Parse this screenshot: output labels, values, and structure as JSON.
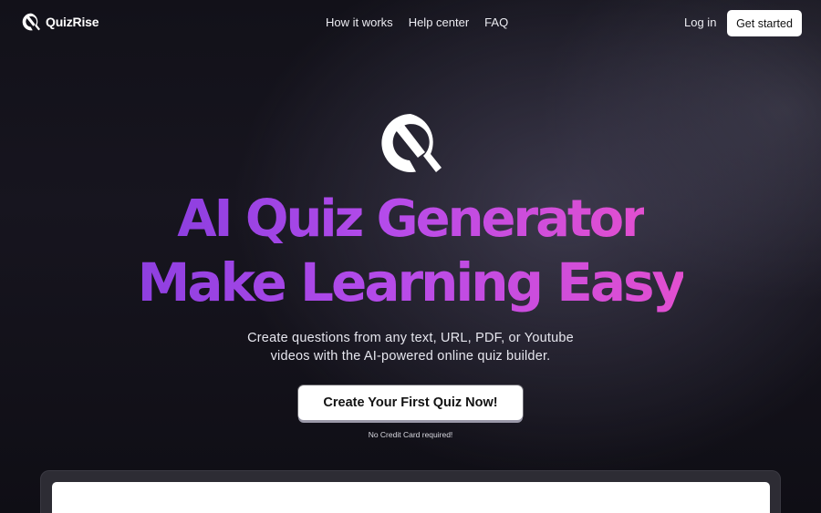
{
  "nav": {
    "brand_name": "QuizRise",
    "links": [
      "How it works",
      "Help center",
      "FAQ"
    ],
    "login_label": "Log in",
    "get_started_label": "Get started"
  },
  "hero": {
    "headline_line1": "AI Quiz Generator",
    "headline_line2": "Make Learning Easy",
    "subtitle_line1": "Create questions from any text, URL, PDF, or Youtube",
    "subtitle_line2": "videos with the AI-powered online quiz builder.",
    "cta_label": "Create Your First Quiz Now!",
    "cta_note": "No Credit Card required!"
  },
  "icons": {
    "brand_logo": "quizrise-logo-icon",
    "hero_logo": "quizrise-logo-icon"
  },
  "colors": {
    "gradient_start": "#8e3fe0",
    "gradient_mid": "#b54bea",
    "gradient_end": "#e24fd0",
    "background": "#121119"
  }
}
